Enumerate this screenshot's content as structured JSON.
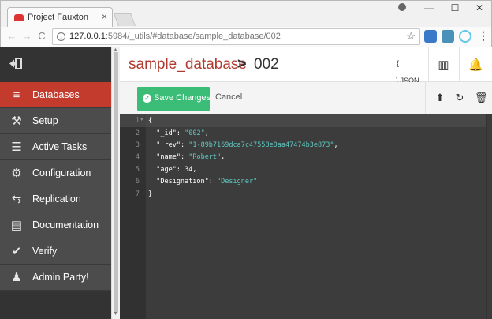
{
  "browser": {
    "tab_title": "Project Fauxton",
    "tab_close": "×",
    "window_buttons": [
      "—",
      "☐",
      "✕"
    ],
    "url_host": "127.0.0.1",
    "url_rest": ":5984/_utils/#database/sample_database/002",
    "info_glyph": "i",
    "star_glyph": "☆",
    "menu_glyph": "⋮",
    "back_glyph": "←",
    "forward_glyph": "→",
    "reload_glyph": "C"
  },
  "sidebar": {
    "items": [
      {
        "label": "Databases",
        "icon": "database-icon",
        "glyph": "≡"
      },
      {
        "label": "Setup",
        "icon": "wrench-icon",
        "glyph": "⚒"
      },
      {
        "label": "Active Tasks",
        "icon": "tasks-icon",
        "glyph": "☰"
      },
      {
        "label": "Configuration",
        "icon": "gear-icon",
        "glyph": "⚙"
      },
      {
        "label": "Replication",
        "icon": "replication-icon",
        "glyph": "⇆"
      },
      {
        "label": "Documentation",
        "icon": "book-icon",
        "glyph": "▤"
      },
      {
        "label": "Verify",
        "icon": "check-circle-icon",
        "glyph": "✔"
      },
      {
        "label": "Admin Party!",
        "icon": "user-icon",
        "glyph": "♟"
      }
    ]
  },
  "header": {
    "database": "sample_database",
    "separator": ">",
    "document": "002",
    "json_brace": "{",
    "json_label": "} JSON",
    "book_glyph": "▥",
    "bell_glyph": "🔔"
  },
  "actions": {
    "save_label": "Save Changes",
    "save_check": "✓",
    "cancel_label": "Cancel",
    "upload_glyph": "⬆",
    "refresh_glyph": "↻",
    "delete_glyph": "🗑"
  },
  "editor": {
    "line_numbers": [
      "1",
      "2",
      "3",
      "4",
      "5",
      "6",
      "7"
    ],
    "lines": [
      {
        "text": "{"
      },
      {
        "key": "\"_id\"",
        "sep": ": ",
        "value": "\"002\"",
        "trail": ","
      },
      {
        "key": "\"_rev\"",
        "sep": ": ",
        "value": "\"1-89b7169dca7c47558e0aa47474b3e873\"",
        "trail": ","
      },
      {
        "key": "\"name\"",
        "sep": ": ",
        "value": "\"Robert\"",
        "trail": ","
      },
      {
        "key": "\"age\"",
        "sep": ": ",
        "value": "34",
        "trail": ","
      },
      {
        "key": "\"Designation\"",
        "sep": ": ",
        "value": "\"Designer\"",
        "trail": ""
      },
      {
        "text": "}"
      }
    ]
  },
  "colors": {
    "accent_red": "#c23b2d",
    "save_green": "#3bbd77",
    "string_teal": "#5fc8c0"
  }
}
